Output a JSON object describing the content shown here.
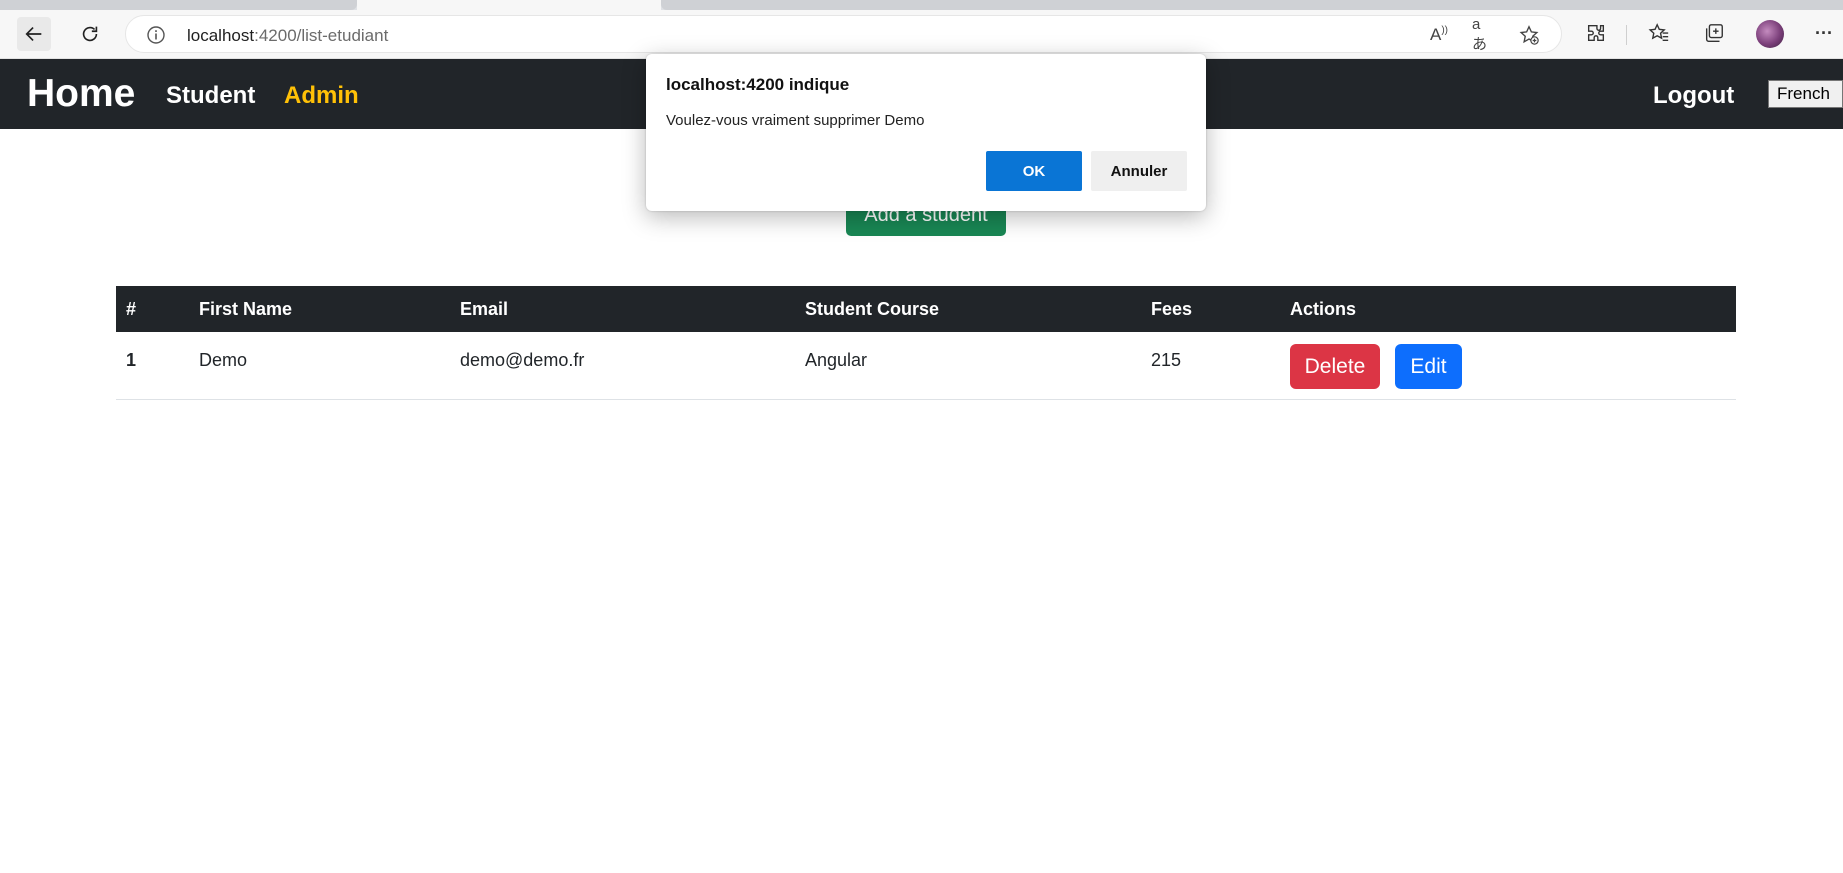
{
  "browser": {
    "url_host": "localhost",
    "url_rest": ":4200/list-etudiant",
    "icons": [
      "back-arrow-icon",
      "reload-icon",
      "site-info-icon",
      "read-aloud-icon",
      "translate-icon",
      "add-favorite-icon",
      "extensions-icon",
      "favorites-icon",
      "collections-icon",
      "profile-avatar-icon",
      "more-menu-icon"
    ],
    "translate_glyph": "aあ",
    "read_aloud_glyph": "A",
    "more_glyph": "···"
  },
  "navbar": {
    "brand": "Home",
    "links": {
      "student": "Student",
      "admin": "Admin",
      "logout": "Logout"
    },
    "language": "French",
    "colors": {
      "background": "#212529",
      "active": "#ffc107"
    }
  },
  "main": {
    "add_button": "Add a student",
    "table": {
      "headers": [
        "#",
        "First Name",
        "Email",
        "Student Course",
        "Fees",
        "Actions"
      ],
      "rows": [
        {
          "index": "1",
          "first_name": "Demo",
          "email": "demo@demo.fr",
          "course": "Angular",
          "fees": "215",
          "delete_label": "Delete",
          "edit_label": "Edit"
        }
      ]
    }
  },
  "dialog": {
    "title": "localhost:4200 indique",
    "message": "Voulez-vous vraiment supprimer Demo",
    "ok_label": "OK",
    "cancel_label": "Annuler"
  }
}
